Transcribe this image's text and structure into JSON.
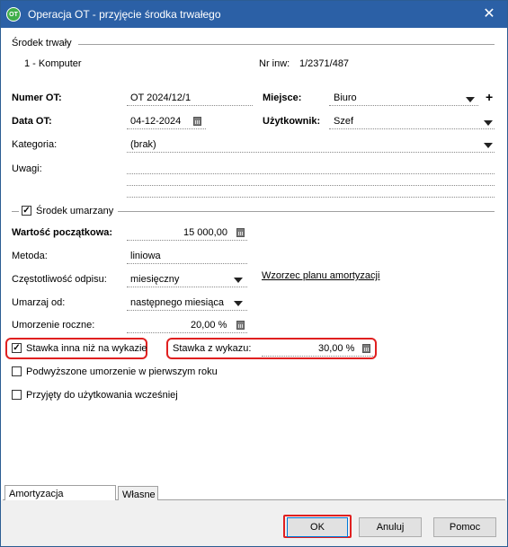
{
  "window": {
    "title": "Operacja OT - przyjęcie środka trwałego",
    "close_glyph": "✕",
    "icon_text": "OT"
  },
  "asset": {
    "section_label": "Środek trwały",
    "name": "1 - Komputer",
    "inv_label": "Nr inw:",
    "inv_value": "1/2371/487"
  },
  "form": {
    "numer_label": "Numer OT:",
    "numer_value": "OT 2024/12/1",
    "data_label": "Data OT:",
    "data_value": "04-12-2024",
    "miejsce_label": "Miejsce:",
    "miejsce_value": "Biuro",
    "uzytkownik_label": "Użytkownik:",
    "uzytkownik_value": "Szef",
    "kategoria_label": "Kategoria:",
    "kategoria_value": "(brak)",
    "uwagi_label": "Uwagi:"
  },
  "depreciation": {
    "section_label": "Środek umarzany",
    "section_checked": true,
    "wartosc_label": "Wartość początkowa:",
    "wartosc_value": "15 000,00",
    "metoda_label": "Metoda:",
    "metoda_value": "liniowa",
    "czestotliwosc_label": "Częstotliwość odpisu:",
    "czestotliwosc_value": "miesięczny",
    "wzorzec_link": "Wzorzec planu amortyzacji",
    "umarzaj_label": "Umarzaj od:",
    "umarzaj_value": "następnego miesiąca",
    "umorzenie_label": "Umorzenie roczne:",
    "umorzenie_value": "20,00 %",
    "stawka_inna_label": "Stawka inna niż na wykazie",
    "stawka_inna_checked": true,
    "stawka_wykaz_label": "Stawka z wykazu:",
    "stawka_wykaz_value": "30,00 %",
    "podwyzszone_label": "Podwyższone umorzenie w pierwszym roku",
    "podwyzszone_checked": false,
    "przyjety_label": "Przyjęty do użytkowania wcześniej",
    "przyjety_checked": false
  },
  "tabs": [
    {
      "label": "Amortyzacja podatkowa",
      "active": true
    },
    {
      "label": "Własne",
      "active": false
    }
  ],
  "buttons": {
    "ok": "OK",
    "cancel": "Anuluj",
    "help": "Pomoc"
  },
  "colors": {
    "titlebar": "#2b60a6",
    "highlight": "#e02020"
  }
}
